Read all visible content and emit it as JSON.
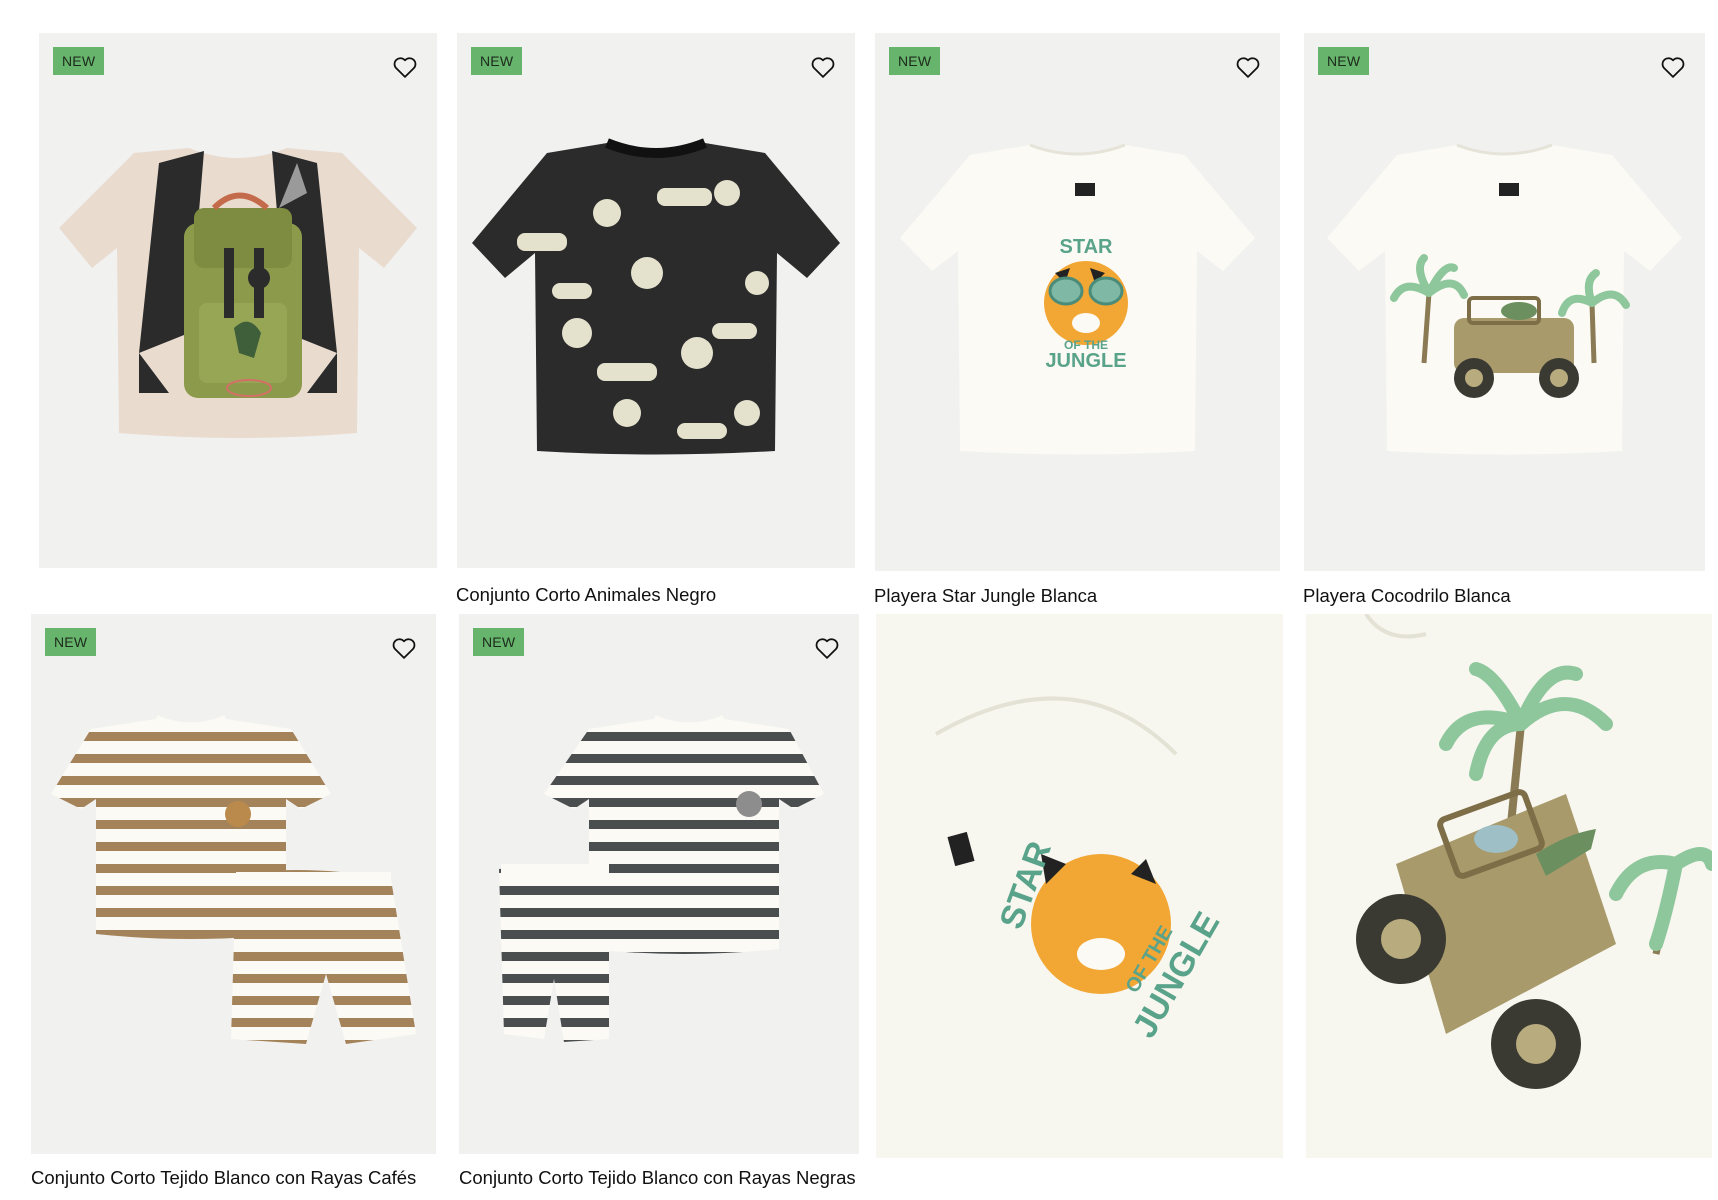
{
  "products": [
    {
      "title": "",
      "badge": "NEW",
      "image": "backpack-print-tee",
      "favorite_icon": "heart-outline-icon"
    },
    {
      "title": "Conjunto Corto Animales Negro",
      "badge": "NEW",
      "image": "black-animal-print-tee",
      "favorite_icon": "heart-outline-icon"
    },
    {
      "title": "Playera Star Jungle Blanca",
      "badge": "NEW",
      "image": "tiger-star-jungle-tee",
      "favorite_icon": "heart-outline-icon",
      "graphic_text": [
        "STAR",
        "OF THE",
        "JUNGLE"
      ]
    },
    {
      "title": "Playera Cocodrilo Blanca",
      "badge": "NEW",
      "image": "crocodile-jeep-tee",
      "favorite_icon": "heart-outline-icon"
    },
    {
      "title": "Conjunto Corto Tejido Blanco con Rayas Cafés",
      "badge": "NEW",
      "image": "brown-stripe-knit-set",
      "favorite_icon": "heart-outline-icon"
    },
    {
      "title": "Conjunto Corto Tejido Blanco con Rayas Negras",
      "badge": "NEW",
      "image": "black-stripe-knit-set",
      "favorite_icon": "heart-outline-icon"
    },
    {
      "title": "",
      "badge": "",
      "image": "tiger-tee-closeup",
      "graphic_text": [
        "STAR",
        "OF THE",
        "JUNGLE"
      ]
    },
    {
      "title": "",
      "badge": "",
      "image": "crocodile-jeep-closeup"
    }
  ],
  "colors": {
    "badge_bg": "#67b46c",
    "image_bg": "#f1f1f0",
    "text": "#111111"
  }
}
